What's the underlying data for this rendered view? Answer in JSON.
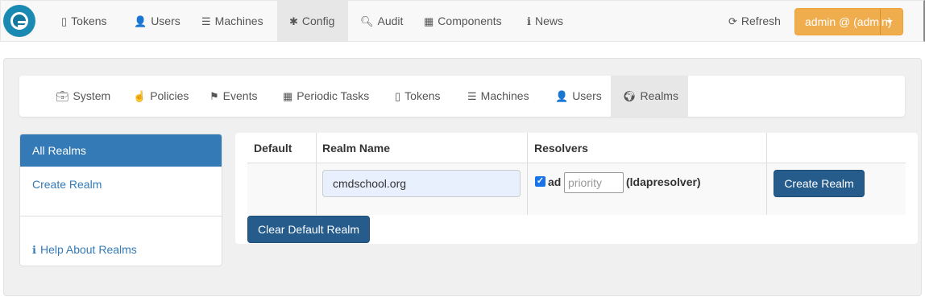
{
  "topnav": {
    "items": [
      {
        "label": "Tokens",
        "icon": "mobile-icon"
      },
      {
        "label": "Users",
        "icon": "user-icon"
      },
      {
        "label": "Machines",
        "icon": "server-icon"
      },
      {
        "label": "Config",
        "icon": "gear-icon",
        "active": true
      },
      {
        "label": "Audit",
        "icon": "search-icon"
      },
      {
        "label": "Components",
        "icon": "calendar-icon"
      },
      {
        "label": "News",
        "icon": "info-icon"
      }
    ],
    "refresh_label": "Refresh",
    "admin_label": "admin @ (admin)"
  },
  "subnav": {
    "items": [
      {
        "label": "System",
        "icon": "briefcase-icon"
      },
      {
        "label": "Policies",
        "icon": "hand-icon"
      },
      {
        "label": "Events",
        "icon": "flag-icon"
      },
      {
        "label": "Periodic Tasks",
        "icon": "calendar-icon"
      },
      {
        "label": "Tokens",
        "icon": "mobile-icon"
      },
      {
        "label": "Machines",
        "icon": "server-icon"
      },
      {
        "label": "Users",
        "icon": "user-icon"
      },
      {
        "label": "Realms",
        "icon": "globe-icon",
        "active": true
      }
    ]
  },
  "sidebar": {
    "all_realms": "All Realms",
    "create_realm": "Create Realm",
    "help": "Help About Realms"
  },
  "table": {
    "headers": [
      "Default",
      "Realm Name",
      "Resolvers",
      ""
    ],
    "realm_name_value": "cmdschool.org",
    "resolver": {
      "checked": true,
      "name": "ad",
      "priority_placeholder": "priority",
      "type": "(ldapresolver)"
    },
    "create_button": "Create Realm",
    "clear_default_button": "Clear Default Realm"
  },
  "colors": {
    "primary": "#337ab7",
    "button_dark": "#255c8c",
    "admin_orange": "#f0ad4e"
  }
}
